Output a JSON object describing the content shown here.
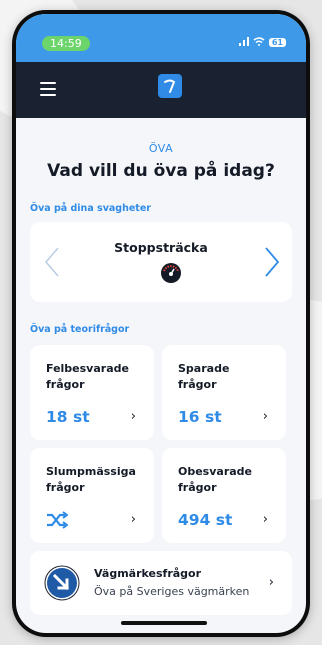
{
  "status_bar": {
    "time": "14:59",
    "battery": "61"
  },
  "header": {
    "logo_icon": "brand-logo-icon",
    "menu_icon": "hamburger-menu-icon"
  },
  "page": {
    "eyebrow": "ÖVA",
    "title": "Vad vill du öva på idag?"
  },
  "weakness_section": {
    "label": "Öva på dina svagheter",
    "carousel_item": "Stoppsträcka",
    "item_icon": "speedometer-icon"
  },
  "theory_section": {
    "label": "Öva på teorifrågor",
    "cards": [
      {
        "title_line1": "Felbesvarade",
        "title_line2": "frågor",
        "value": "18 st"
      },
      {
        "title_line1": "Sparade frågor",
        "title_line2": "",
        "value": "16 st"
      },
      {
        "title_line1": "Slumpmässiga",
        "title_line2": "frågor",
        "value": "",
        "icon": "shuffle-icon"
      },
      {
        "title_line1": "Obesvarade",
        "title_line2": "frågor",
        "value": "494 st"
      }
    ]
  },
  "sign_card": {
    "title": "Vägmärkesfrågor",
    "subtitle": "Öva på Sveriges vägmärken",
    "icon": "road-sign-icon"
  },
  "colors": {
    "accent": "#2f8be6",
    "navbar": "#1a2130",
    "statusbar": "#3e9ae8",
    "background": "#f4f6fa"
  }
}
